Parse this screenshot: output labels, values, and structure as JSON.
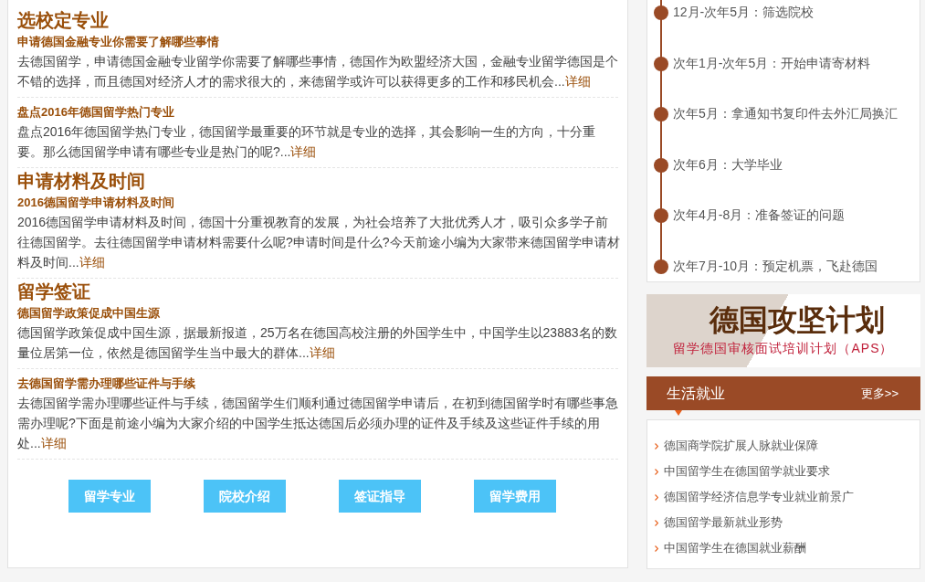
{
  "sections": [
    {
      "title": "选校定专业",
      "articles": [
        {
          "title": "申请德国金融专业你需要了解哪些事情",
          "summary": "去德国留学，申请德国金融专业留学你需要了解哪些事情，德国作为欧盟经济大国，金融专业留学德国是个不错的选择，而且德国对经济人才的需求很大的，来德留学或许可以获得更多的工作和移民机会...",
          "more": "详细"
        },
        {
          "title": "盘点2016年德国留学热门专业",
          "summary": "盘点2016年德国留学热门专业，德国留学最重要的环节就是专业的选择，其会影响一生的方向，十分重要。那么德国留学申请有哪些专业是热门的呢?...",
          "more": "详细"
        }
      ]
    },
    {
      "title": "申请材料及时间",
      "articles": [
        {
          "title": "2016德国留学申请材料及时间",
          "summary": "2016德国留学申请材料及时间，德国十分重视教育的发展，为社会培养了大批优秀人才，吸引众多学子前往德国留学。去往德国留学申请材料需要什么呢?申请时间是什么?今天前途小编为大家带来德国留学申请材料及时间...",
          "more": "详细"
        }
      ]
    },
    {
      "title": "留学签证",
      "articles": [
        {
          "title": "德国留学政策促成中国生源",
          "summary": "德国留学政策促成中国生源，据最新报道，25万名在德国高校注册的外国学生中，中国学生以23883名的数量位居第一位，依然是德国留学生当中最大的群体...",
          "more": "详细"
        },
        {
          "title": "去德国留学需办理哪些证件与手续",
          "summary": "去德国留学需办理哪些证件与手续，德国留学生们顺利通过德国留学申请后，在初到德国留学时有哪些事急需办理呢?下面是前途小编为大家介绍的中国学生抵达德国后必须办理的证件及手续及这些证件手续的用处...",
          "more": "详细"
        }
      ]
    }
  ],
  "buttons": [
    "留学专业",
    "院校介绍",
    "签证指导",
    "留学费用"
  ],
  "timeline": [
    "12月-次年5月：筛选院校",
    "次年1月-次年5月：开始申请寄材料",
    "次年5月：拿通知书复印件去外汇局换汇",
    "次年6月：大学毕业",
    "次年4月-8月：准备签证的问题",
    "次年7月-10月：预定机票，飞赴德国"
  ],
  "banner": {
    "title": "德国攻坚计划",
    "subtitle": "留学德国审核面试培训计划（APS）"
  },
  "jobs": {
    "title": "生活就业",
    "more": "更多>>",
    "items": [
      "德国商学院扩展人脉就业保障",
      "中国留学生在德国留学就业要求",
      "德国留学经济信息学专业就业前景广",
      "德国留学最新就业形势",
      "中国留学生在德国就业薪酬"
    ]
  }
}
